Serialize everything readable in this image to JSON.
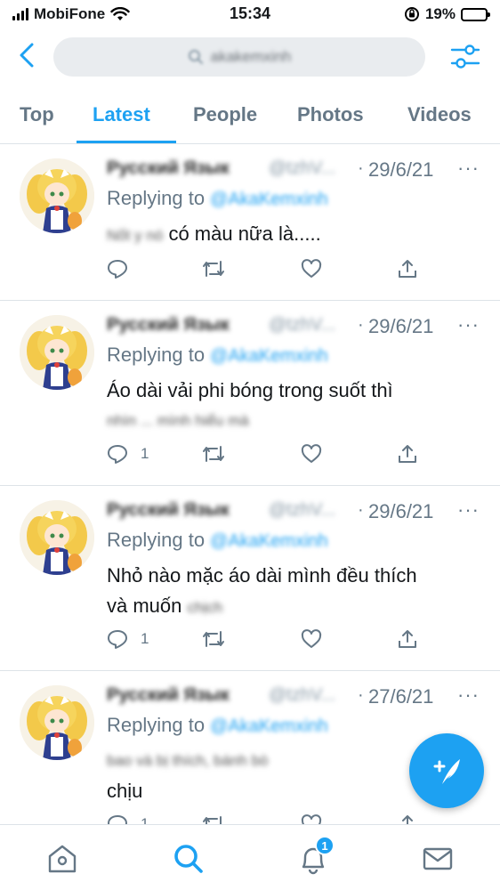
{
  "status_bar": {
    "carrier": "MobiFone",
    "time": "15:34",
    "battery": "19%",
    "battery_level": 0.19
  },
  "search": {
    "query": "akakemxinh"
  },
  "tabs": [
    {
      "label": "Top"
    },
    {
      "label": "Latest"
    },
    {
      "label": "People"
    },
    {
      "label": "Photos"
    },
    {
      "label": "Videos"
    }
  ],
  "active_tab": "Latest",
  "tweets": [
    {
      "name": "Русский Язык",
      "handle": "@tzhV...",
      "dot": "·",
      "date": "29/6/21",
      "replying_label": "Replying to",
      "replying_handle": "@AkaKemxinh",
      "blurred_prefix": "Nốt y nó",
      "text": "có màu nữa là.....",
      "line2": "",
      "replies": "",
      "more": "···"
    },
    {
      "name": "Русский Язык",
      "handle": "@tzhV...",
      "dot": "·",
      "date": "29/6/21",
      "replying_label": "Replying to",
      "replying_handle": "@AkaKemxinh",
      "blurred_prefix": "",
      "text": "Áo dài vải phi bóng trong suốt thì",
      "line2": "nhìn ... mình hiểu mà",
      "replies": "1",
      "more": "···"
    },
    {
      "name": "Русский Язык",
      "handle": "@tzhV...",
      "dot": "·",
      "date": "29/6/21",
      "replying_label": "Replying to",
      "replying_handle": "@AkaKemxinh",
      "blurred_prefix": "",
      "text": "Nhỏ nào mặc áo dài mình đều thích",
      "line2": "và muốn",
      "line2_blur": "chịch",
      "replies": "1",
      "more": "···"
    },
    {
      "name": "Русский Язык",
      "handle": "@tzhV...",
      "dot": "·",
      "date": "27/6/21",
      "replying_label": "Replying to",
      "replying_handle": "@AkaKemxinh",
      "blurred_prefix": "",
      "text": "",
      "line1_blur": "bao và bị thích, bánh bò",
      "line2": "chịu",
      "replies": "1",
      "more": "···"
    }
  ],
  "bottom_nav": {
    "notifications_badge": "1"
  },
  "colors": {
    "accent": "#1da1f2",
    "muted": "#657786",
    "divider": "#dde3e8"
  },
  "icons": [
    "back-arrow-icon",
    "search-icon",
    "filter-sliders-icon",
    "reply-icon",
    "retweet-icon",
    "like-icon",
    "share-icon",
    "compose-tweet-icon",
    "home-icon",
    "notifications-bell-icon",
    "messages-mail-icon"
  ]
}
